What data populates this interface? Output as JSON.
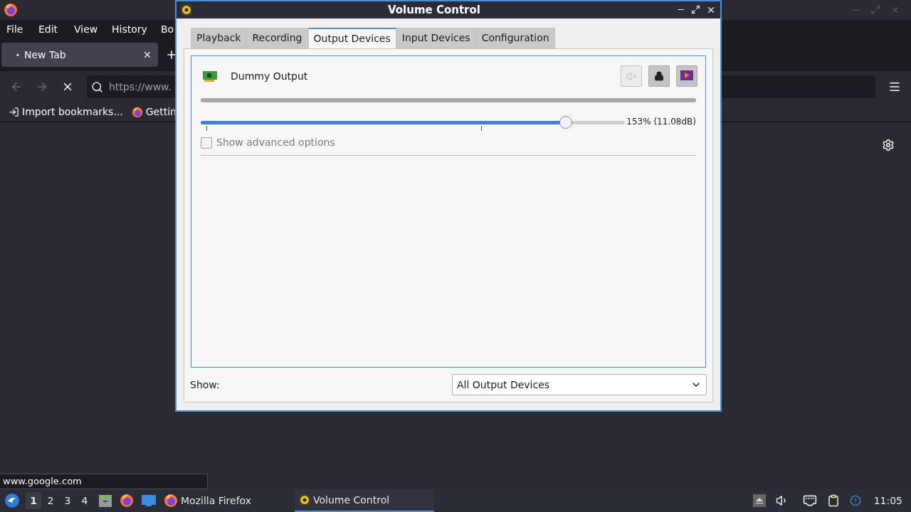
{
  "browser": {
    "menu": [
      "File",
      "Edit",
      "View",
      "History",
      "Bo"
    ],
    "tabs": [
      {
        "label": "New Tab",
        "indicator": "•",
        "selected": true
      }
    ],
    "url_field": {
      "value": "https://www."
    },
    "bookmarks": [
      "Import bookmarks...",
      "Gettin"
    ],
    "status_text": "www.google.com"
  },
  "volume_window": {
    "title": "Volume Control",
    "tabs": [
      {
        "label": "Playback",
        "selected": false
      },
      {
        "label": "Recording",
        "selected": false
      },
      {
        "label": "Output Devices",
        "selected": true
      },
      {
        "label": "Input Devices",
        "selected": false
      },
      {
        "label": "Configuration",
        "selected": false
      }
    ],
    "device": {
      "name": "Dummy Output",
      "mute": {
        "on": false,
        "disabled": true
      },
      "lock": {
        "on": true
      },
      "default": {
        "on": true
      },
      "level": 0.86,
      "reading": "153% (11.08dB)",
      "advanced": {
        "label": "Show advanced options",
        "checked": false
      }
    },
    "show_label": "Show:",
    "show_select": "All Output Devices"
  },
  "taskbar": {
    "workspaces": [
      {
        "label": "1",
        "selected": true
      },
      {
        "label": "2",
        "selected": false
      },
      {
        "label": "3",
        "selected": false
      },
      {
        "label": "4",
        "selected": false
      }
    ],
    "tasks": [
      {
        "label": "Mozilla Firefox",
        "kind": "firefox",
        "selected": false
      },
      {
        "label": "Volume Control",
        "kind": "volume",
        "selected": true
      }
    ],
    "clock": "11:05"
  }
}
